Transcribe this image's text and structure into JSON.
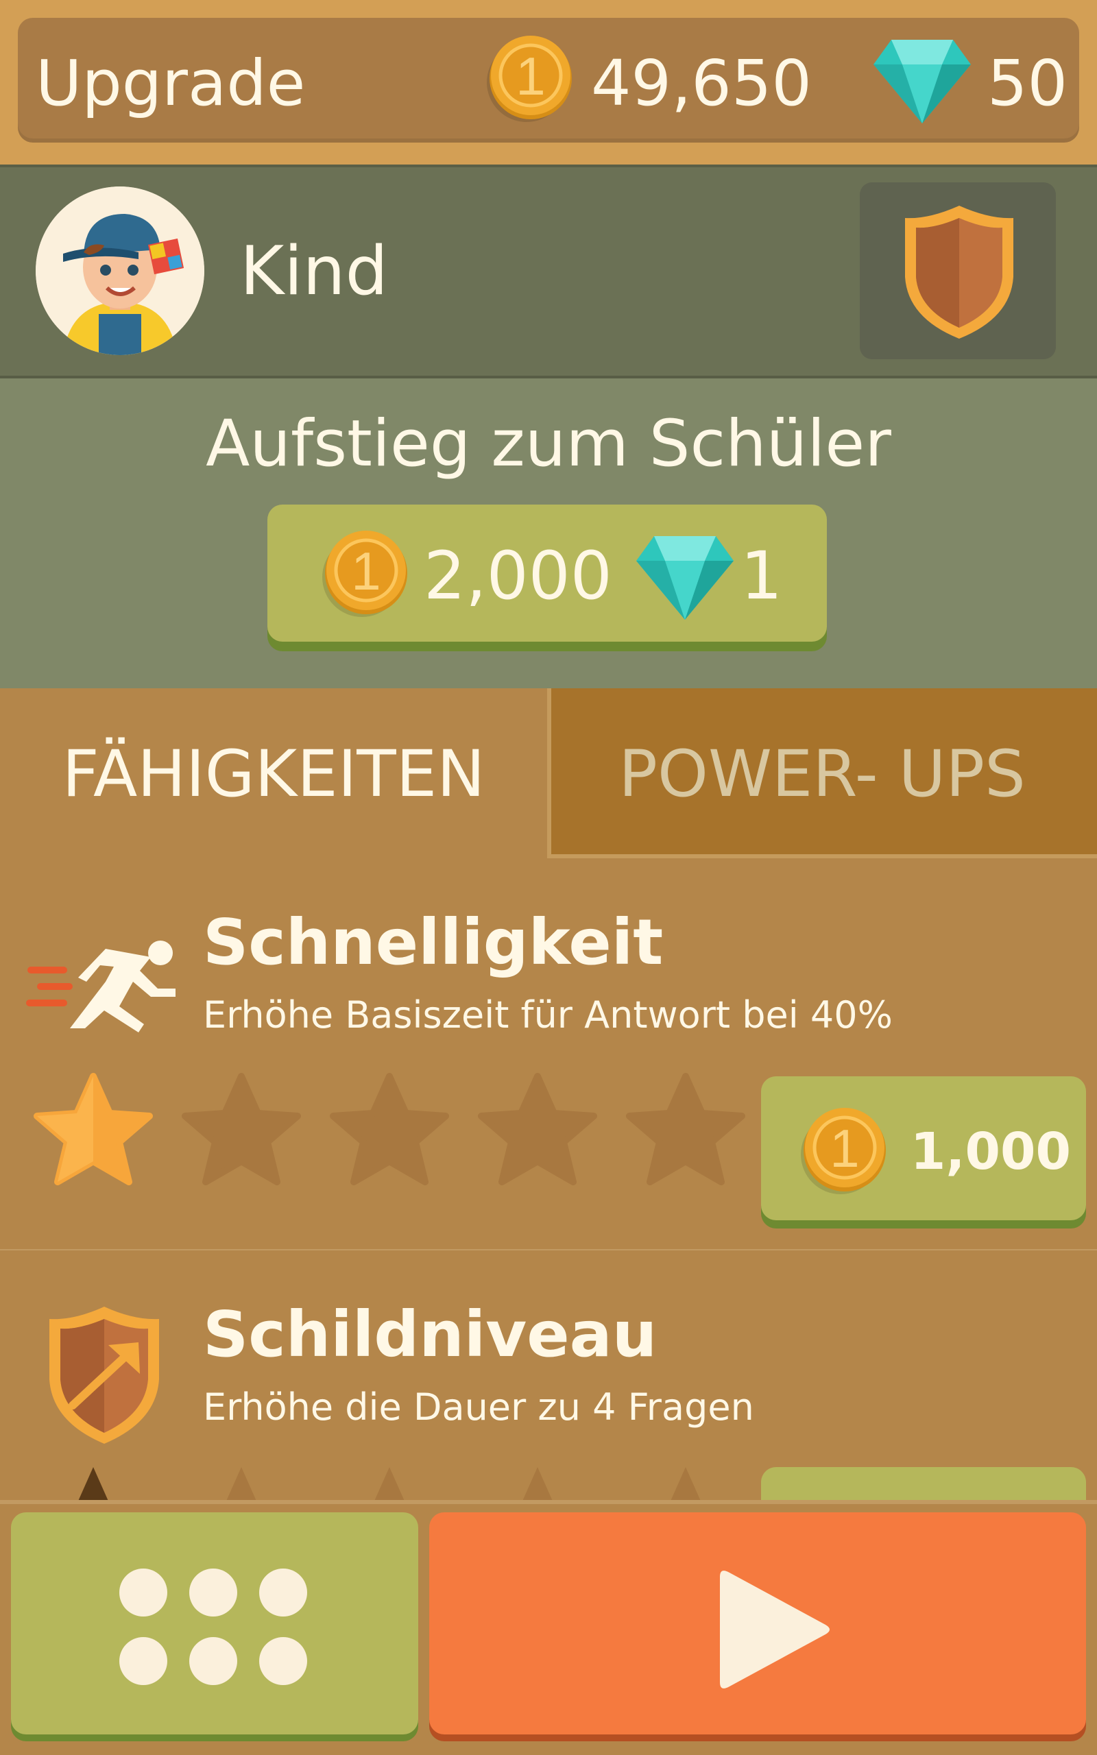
{
  "header": {
    "title": "Upgrade",
    "coins": "49,650",
    "gems": "50"
  },
  "profile": {
    "rank_name": "Kind"
  },
  "rank_up": {
    "title": "Aufstieg zum Schüler",
    "cost_coins": "2,000",
    "cost_gems": "1"
  },
  "tabs": {
    "abilities": "FÄHIGKEITEN",
    "powerups": "POWER- UPS",
    "active": "abilities"
  },
  "skills": [
    {
      "title": "Schnelligkeit",
      "description": "Erhöhe Basiszeit für Antwort bei 40%",
      "stars_filled": 1,
      "stars_total": 5,
      "price": "1,000"
    },
    {
      "title": "Schildniveau",
      "description": "Erhöhe die Dauer zu 4 Fragen"
    }
  ],
  "colors": {
    "coin": "#f0a82b",
    "gem": "#3fd3c7",
    "star_filled": "#f7a63b",
    "play": "#f57a3f",
    "green_button": "#b5b75b"
  },
  "icons": {
    "coin": "coin-icon",
    "gem": "diamond-icon",
    "shield": "shield-icon",
    "runner": "runner-icon",
    "menu": "grid-dots-icon",
    "play": "play-icon"
  }
}
